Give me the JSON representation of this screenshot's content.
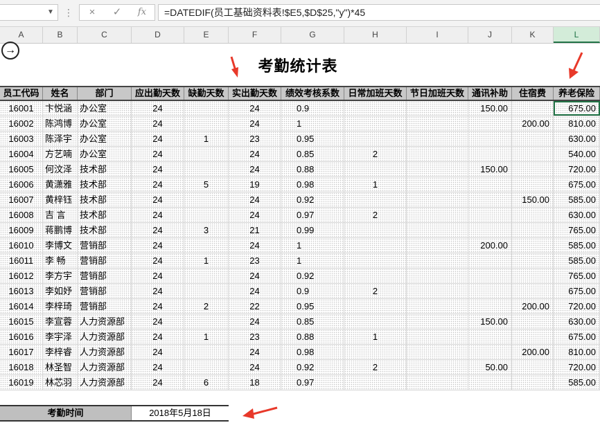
{
  "formula_bar": {
    "name_box": "",
    "cancel_icon": "×",
    "enter_icon": "✓",
    "fx_label": "fx",
    "formula": "=DATEDIF(员工基础资料表!$E5,$D$25,\"y\")*45"
  },
  "columns": [
    {
      "letter": "A"
    },
    {
      "letter": "B"
    },
    {
      "letter": "C"
    },
    {
      "letter": "D"
    },
    {
      "letter": "E"
    },
    {
      "letter": "F"
    },
    {
      "letter": "G"
    },
    {
      "letter": "H"
    },
    {
      "letter": "I"
    },
    {
      "letter": "J"
    },
    {
      "letter": "K"
    },
    {
      "letter": "L"
    }
  ],
  "sheet": {
    "title": "考勤统计表",
    "headers": [
      "员工代码",
      "姓名",
      "部门",
      "应出勤天数",
      "缺勤天数",
      "实出勤天数",
      "绩效考核系数",
      "日常加班天数",
      "节日加班天数",
      "通讯补助",
      "住宿费",
      "养老保险"
    ],
    "rows": [
      [
        "16001",
        "卞悦涵",
        "办公室",
        "24",
        "",
        "24",
        "0.9",
        "",
        "",
        "150.00",
        "",
        "675.00"
      ],
      [
        "16002",
        "陈鸿博",
        "办公室",
        "24",
        "",
        "24",
        "1",
        "",
        "",
        "",
        "200.00",
        "810.00"
      ],
      [
        "16003",
        "陈泽宇",
        "办公室",
        "24",
        "1",
        "23",
        "0.95",
        "",
        "",
        "",
        "",
        "630.00"
      ],
      [
        "16004",
        "方艺喃",
        "办公室",
        "24",
        "",
        "24",
        "0.85",
        "2",
        "",
        "",
        "",
        "540.00"
      ],
      [
        "16005",
        "何汶泽",
        "技术部",
        "24",
        "",
        "24",
        "0.88",
        "",
        "",
        "150.00",
        "",
        "720.00"
      ],
      [
        "16006",
        "黄潇雅",
        "技术部",
        "24",
        "5",
        "19",
        "0.98",
        "1",
        "",
        "",
        "",
        "675.00"
      ],
      [
        "16007",
        "黄梓钰",
        "技术部",
        "24",
        "",
        "24",
        "0.92",
        "",
        "",
        "",
        "150.00",
        "585.00"
      ],
      [
        "16008",
        "吉  言",
        "技术部",
        "24",
        "",
        "24",
        "0.97",
        "2",
        "",
        "",
        "",
        "630.00"
      ],
      [
        "16009",
        "蒋鹏博",
        "技术部",
        "24",
        "3",
        "21",
        "0.99",
        "",
        "",
        "",
        "",
        "765.00"
      ],
      [
        "16010",
        "李博文",
        "营销部",
        "24",
        "",
        "24",
        "1",
        "",
        "",
        "200.00",
        "",
        "585.00"
      ],
      [
        "16011",
        "李  畅",
        "营销部",
        "24",
        "1",
        "23",
        "1",
        "",
        "",
        "",
        "",
        "585.00"
      ],
      [
        "16012",
        "李方宇",
        "营销部",
        "24",
        "",
        "24",
        "0.92",
        "",
        "",
        "",
        "",
        "765.00"
      ],
      [
        "16013",
        "李如妤",
        "营销部",
        "24",
        "",
        "24",
        "0.9",
        "2",
        "",
        "",
        "",
        "675.00"
      ],
      [
        "16014",
        "李梓琦",
        "营销部",
        "24",
        "2",
        "22",
        "0.95",
        "",
        "",
        "",
        "200.00",
        "720.00"
      ],
      [
        "16015",
        "李宣蓉",
        "人力资源部",
        "24",
        "",
        "24",
        "0.85",
        "",
        "",
        "150.00",
        "",
        "630.00"
      ],
      [
        "16016",
        "李宇泽",
        "人力资源部",
        "24",
        "1",
        "23",
        "0.88",
        "1",
        "",
        "",
        "",
        "675.00"
      ],
      [
        "16017",
        "李梓睿",
        "人力资源部",
        "24",
        "",
        "24",
        "0.98",
        "",
        "",
        "",
        "200.00",
        "810.00"
      ],
      [
        "16018",
        "林圣智",
        "人力资源部",
        "24",
        "",
        "24",
        "0.92",
        "2",
        "",
        "50.00",
        "",
        "720.00"
      ],
      [
        "16019",
        "林芯羽",
        "人力资源部",
        "24",
        "6",
        "18",
        "0.97",
        "",
        "",
        "",
        "",
        "585.00"
      ]
    ],
    "footer_label": "考勤时间",
    "footer_value": "2018年5月18日"
  },
  "colors": {
    "accent": "#217346",
    "arrow": "#e8392a",
    "header_fill": "#c8c8c8"
  }
}
